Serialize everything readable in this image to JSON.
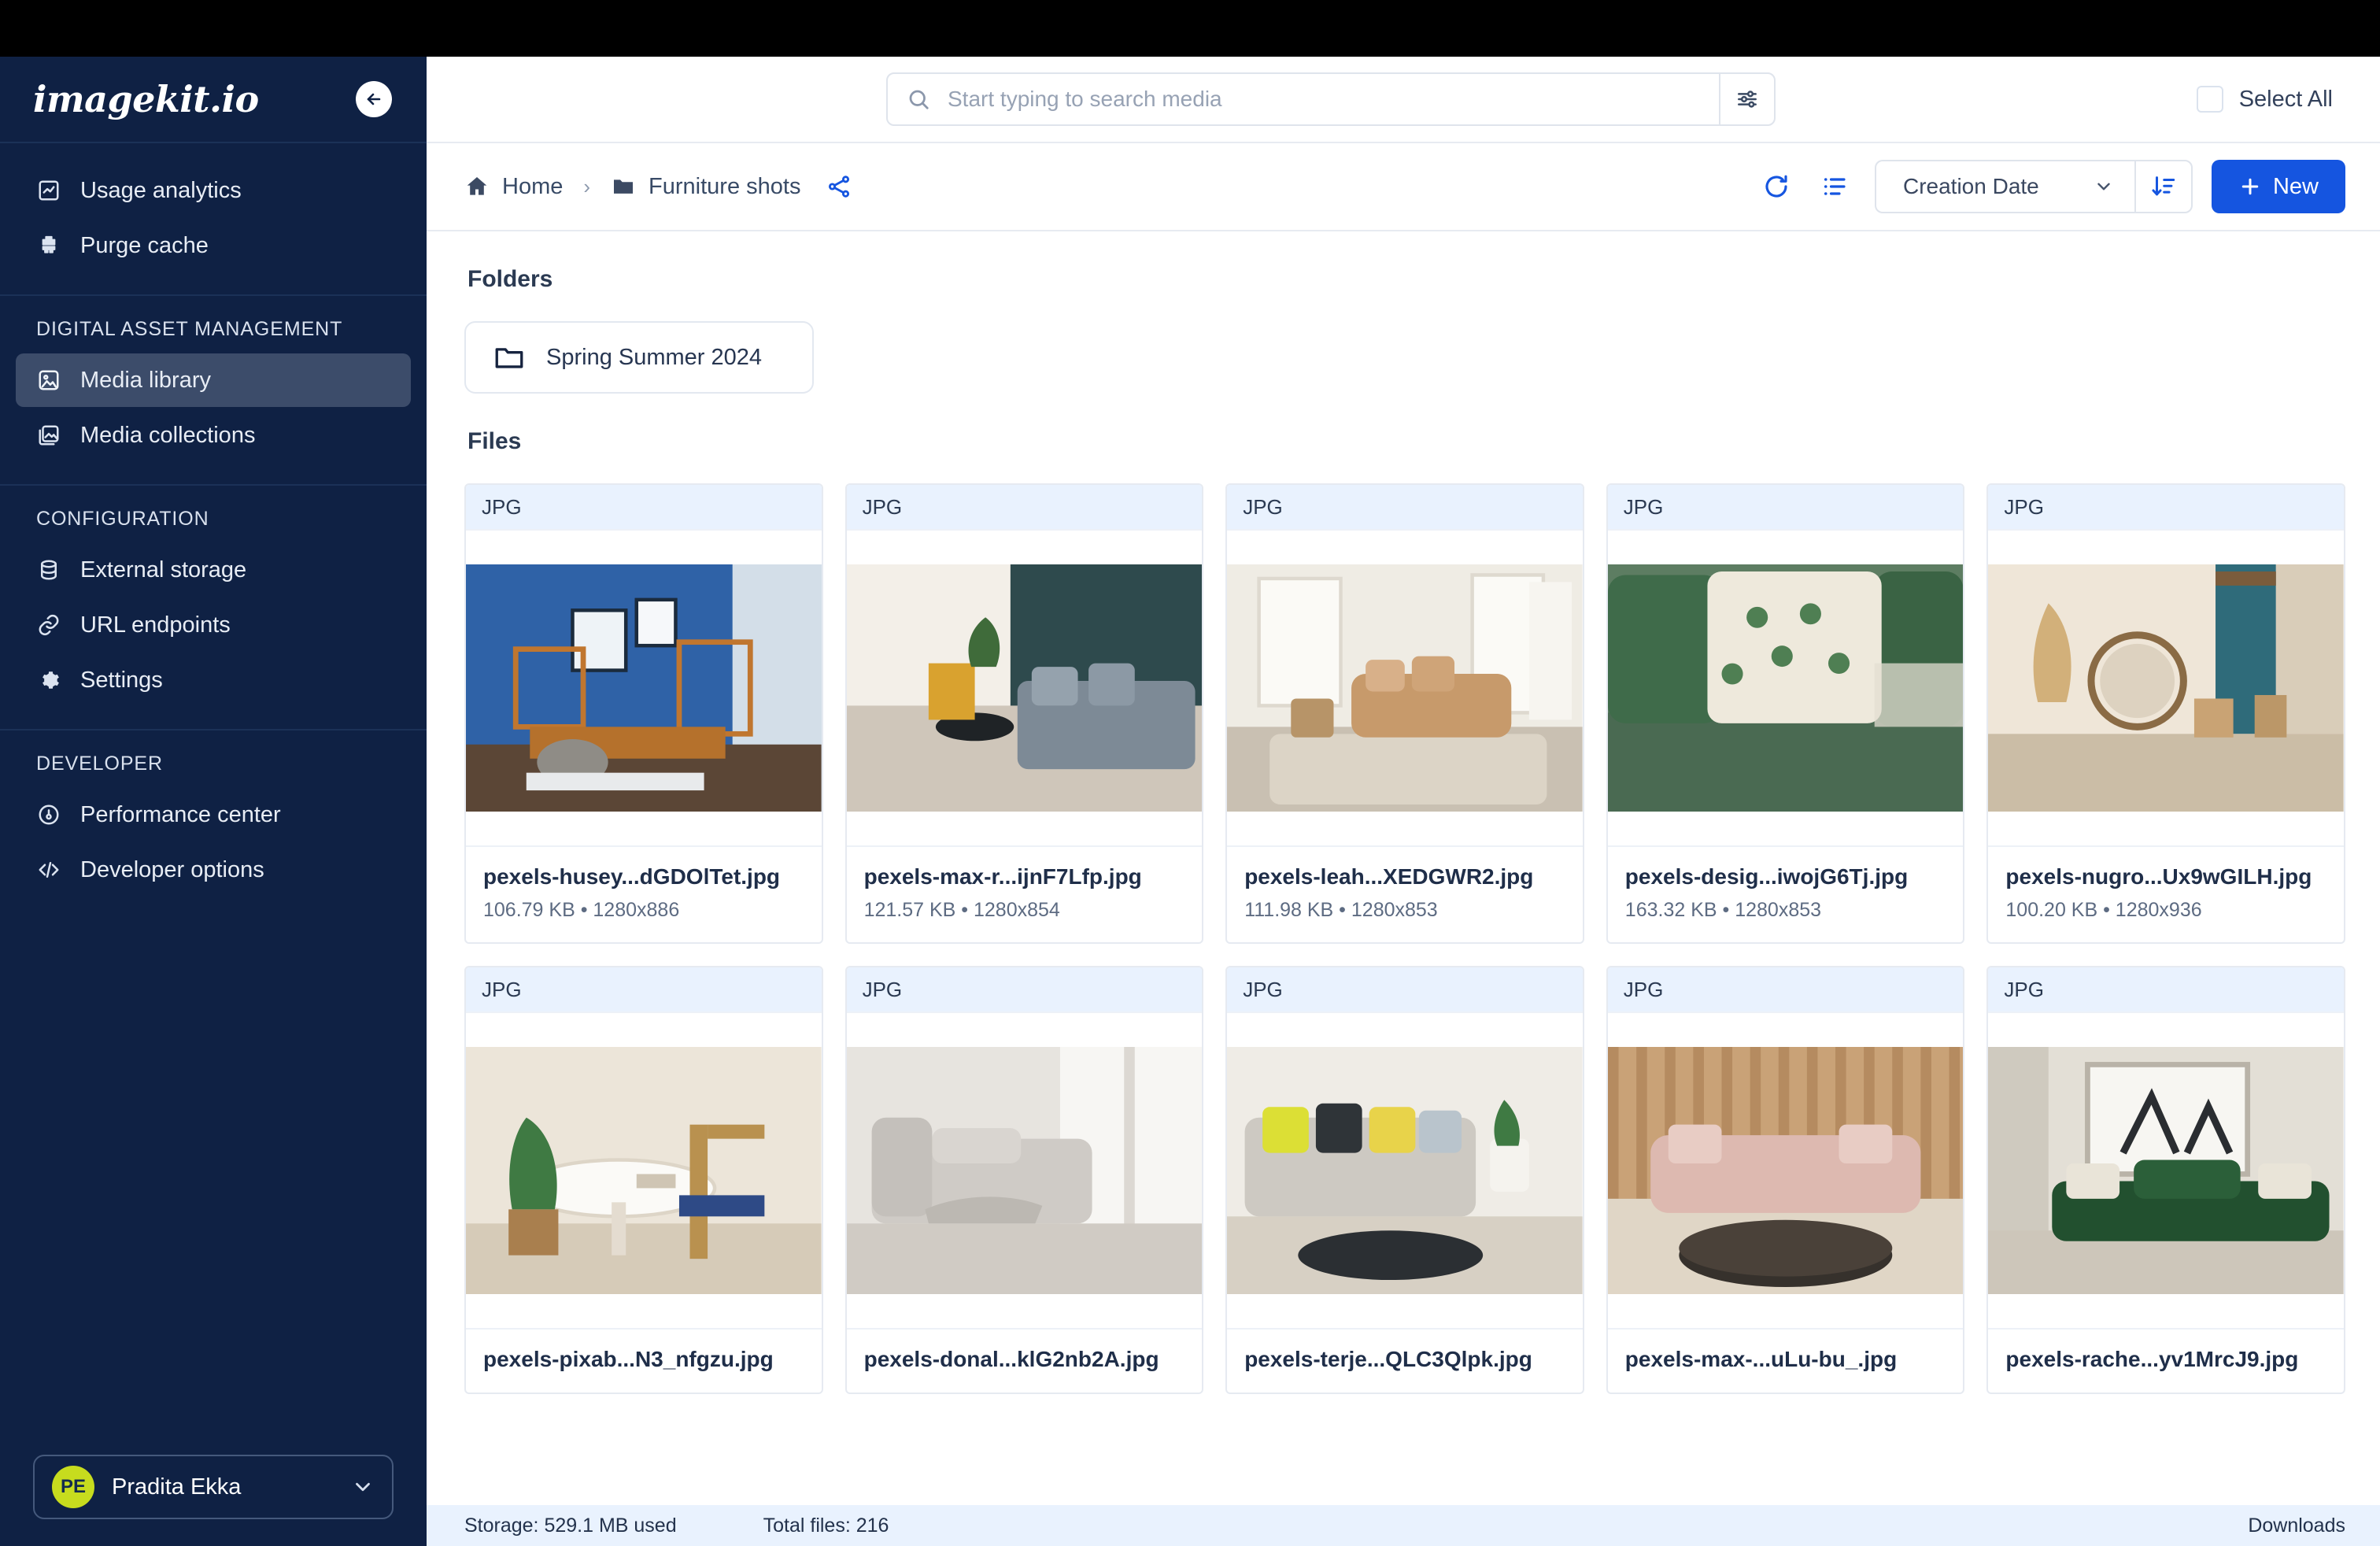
{
  "sidebar": {
    "logo": "imagekit.io",
    "collapse_icon": "arrow-left-circle-icon",
    "top_items": [
      {
        "label": "Usage analytics",
        "icon": "analytics-icon"
      },
      {
        "label": "Purge cache",
        "icon": "purge-cache-icon"
      }
    ],
    "sections": [
      {
        "title": "DIGITAL ASSET MANAGEMENT",
        "items": [
          {
            "label": "Media library",
            "icon": "image-icon",
            "active": true
          },
          {
            "label": "Media collections",
            "icon": "collections-icon",
            "active": false
          }
        ]
      },
      {
        "title": "CONFIGURATION",
        "items": [
          {
            "label": "External storage",
            "icon": "database-icon",
            "active": false
          },
          {
            "label": "URL endpoints",
            "icon": "link-icon",
            "active": false
          },
          {
            "label": "Settings",
            "icon": "gear-icon",
            "active": false
          }
        ]
      },
      {
        "title": "DEVELOPER",
        "items": [
          {
            "label": "Performance center",
            "icon": "gauge-icon",
            "active": false
          },
          {
            "label": "Developer options",
            "icon": "code-icon",
            "active": false
          }
        ]
      }
    ],
    "profile": {
      "initials": "PE",
      "name": "Pradita Ekka",
      "chevron_icon": "chevron-down-icon",
      "avatar_color": "#c7dc1e"
    }
  },
  "header": {
    "search": {
      "placeholder": "Start typing to search media",
      "value": "",
      "icon": "search-icon",
      "filter_icon": "filter-sliders-icon"
    },
    "select_all": {
      "label": "Select All",
      "checked": false
    }
  },
  "breadcrumb": {
    "home": {
      "label": "Home",
      "icon": "home-icon"
    },
    "separator": "›",
    "current": {
      "label": "Furniture shots",
      "icon": "folder-filled-icon"
    },
    "share_icon": "share-icon"
  },
  "toolbar": {
    "refresh_icon": "refresh-icon",
    "list_view_icon": "list-view-icon",
    "sort_field": "Creation Date",
    "sort_chevron_icon": "chevron-down-icon",
    "sort_direction_icon": "sort-descending-icon",
    "new_button": {
      "label": "New",
      "icon": "plus-icon",
      "color": "#1555e0"
    }
  },
  "content": {
    "folders_title": "Folders",
    "files_title": "Files",
    "folders": [
      {
        "name": "Spring Summer 2024",
        "icon": "folder-outline-icon"
      }
    ],
    "files": [
      {
        "badge": "JPG",
        "name": "pexels-husey...dGDOlTet.jpg",
        "size": "106.79 KB",
        "dimensions": "1280x886",
        "thumb": "blue-office-room"
      },
      {
        "badge": "JPG",
        "name": "pexels-max-r...ijnF7Lfp.jpg",
        "size": "121.57 KB",
        "dimensions": "1280x854",
        "thumb": "living-room-grey-sofa"
      },
      {
        "badge": "JPG",
        "name": "pexels-leah...XEDGWR2.jpg",
        "size": "111.98 KB",
        "dimensions": "1280x853",
        "thumb": "bright-living-room-tan-sofa"
      },
      {
        "badge": "JPG",
        "name": "pexels-desig...iwojG6Tj.jpg",
        "size": "163.32 KB",
        "dimensions": "1280x853",
        "thumb": "green-cushions-closeup"
      },
      {
        "badge": "JPG",
        "name": "pexels-nugro...Ux9wGILH.jpg",
        "size": "100.20 KB",
        "dimensions": "1280x936",
        "thumb": "boho-mirror-corner"
      },
      {
        "badge": "JPG",
        "name": "pexels-pixab...N3_nfgzu.jpg",
        "size": "",
        "dimensions": "",
        "thumb": "round-table-plant"
      },
      {
        "badge": "JPG",
        "name": "pexels-donal...klG2nb2A.jpg",
        "size": "",
        "dimensions": "",
        "thumb": "grey-sofa-window"
      },
      {
        "badge": "JPG",
        "name": "pexels-terje...QLC3Qlpk.jpg",
        "size": "",
        "dimensions": "",
        "thumb": "sofa-yellow-pillows"
      },
      {
        "badge": "JPG",
        "name": "pexels-max-...uLu-bu_.jpg",
        "size": "",
        "dimensions": "",
        "thumb": "pink-sofa-round-table"
      },
      {
        "badge": "JPG",
        "name": "pexels-rache...yv1MrcJ9.jpg",
        "size": "",
        "dimensions": "",
        "thumb": "green-velvet-sofa"
      }
    ]
  },
  "statusbar": {
    "storage": "Storage: 529.1 MB used",
    "total_files": "Total files: 216",
    "downloads": "Downloads"
  }
}
